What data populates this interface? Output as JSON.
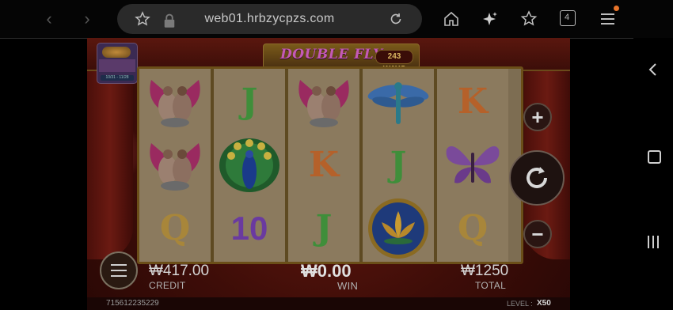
{
  "browser": {
    "url": "web01.hrbzycpzs.com",
    "tab_count": "4",
    "icons": [
      "back-arrow-icon",
      "forward-arrow-icon",
      "star-icon",
      "lock-icon",
      "reload-icon",
      "home-icon",
      "sparkle-icon",
      "favorites-icon",
      "tabs-icon",
      "menu-icon"
    ],
    "notification_dot_color": "#e8742a"
  },
  "system_nav": {
    "icons": [
      "back-chevron-icon",
      "home-square-icon",
      "recents-icon"
    ]
  },
  "game": {
    "title": "DOUBLE FLY",
    "ways": "243 WAYS",
    "event_badge": {
      "date": "10/31 - 11/28"
    },
    "reels": [
      [
        "lovebirds",
        "lovebirds",
        "Q"
      ],
      [
        "J",
        "peacock",
        "10"
      ],
      [
        "lovebirds",
        "K",
        "J"
      ],
      [
        "dragonfly",
        "J",
        "lotus"
      ],
      [
        "K",
        "butterfly",
        "Q"
      ]
    ],
    "credit": {
      "value": "₩417.00",
      "label": "CREDIT"
    },
    "win": {
      "value": "₩0.00",
      "label": "WIN"
    },
    "total": {
      "value": "₩1250",
      "label": "TOTAL"
    },
    "account_id": "715612235229",
    "level": {
      "label": "LEVEL :",
      "value": "X50"
    },
    "controls": {
      "increase": "+",
      "decrease": "−"
    },
    "colors": {
      "frame_gold": "#6b4e18",
      "letter_green": "#3f8e3a",
      "letter_gold": "#a8863a",
      "letter_orange": "#b5612a",
      "number_purple": "#6a3aa0"
    }
  }
}
